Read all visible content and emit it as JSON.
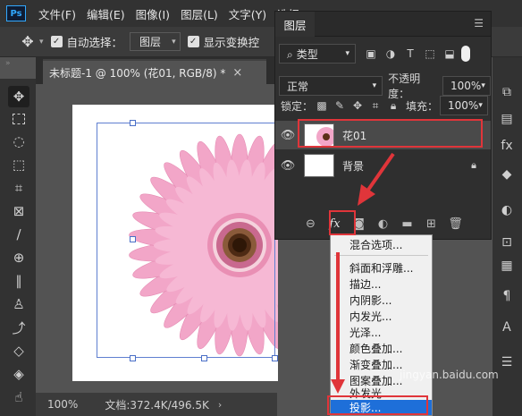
{
  "app": {
    "logo": "Ps"
  },
  "menubar": {
    "items": [
      "文件(F)",
      "编辑(E)",
      "图像(I)",
      "图层(L)",
      "文字(Y)",
      "选择"
    ]
  },
  "options_bar": {
    "auto_select_label": "自动选择：",
    "auto_select_value": "图层",
    "show_transform_label": "显示变换控"
  },
  "document": {
    "tab_title": "未标题-1 @ 100% (花01, RGB/8) *",
    "close_glyph": "×"
  },
  "status_bar": {
    "zoom": "100%",
    "doc_size": "文档:372.4K/496.5K",
    "arrow": "›"
  },
  "layers_panel": {
    "tab": "图层",
    "filter_kind": "类型",
    "blend_mode": "正常",
    "opacity_label": "不透明度：",
    "opacity_value": "100%",
    "lock_label": "锁定：",
    "fill_label": "填充：",
    "fill_value": "100%",
    "layers": [
      {
        "name": "花01",
        "selected": true
      },
      {
        "name": "背景",
        "locked": true
      }
    ],
    "fx_label": "fx"
  },
  "fx_menu": {
    "items": [
      "混合选项...",
      "斜面和浮雕...",
      "描边...",
      "内阴影...",
      "内发光...",
      "光泽...",
      "颜色叠加...",
      "渐变叠加...",
      "图案叠加...",
      "外发光...",
      "投影..."
    ],
    "selected": "投影..."
  },
  "watermark": "jingyan.baidu.com",
  "colors": {
    "accent_red": "#e0353a",
    "menu_select": "#1e6fd9",
    "petal_pink": "#f2a6c8"
  }
}
